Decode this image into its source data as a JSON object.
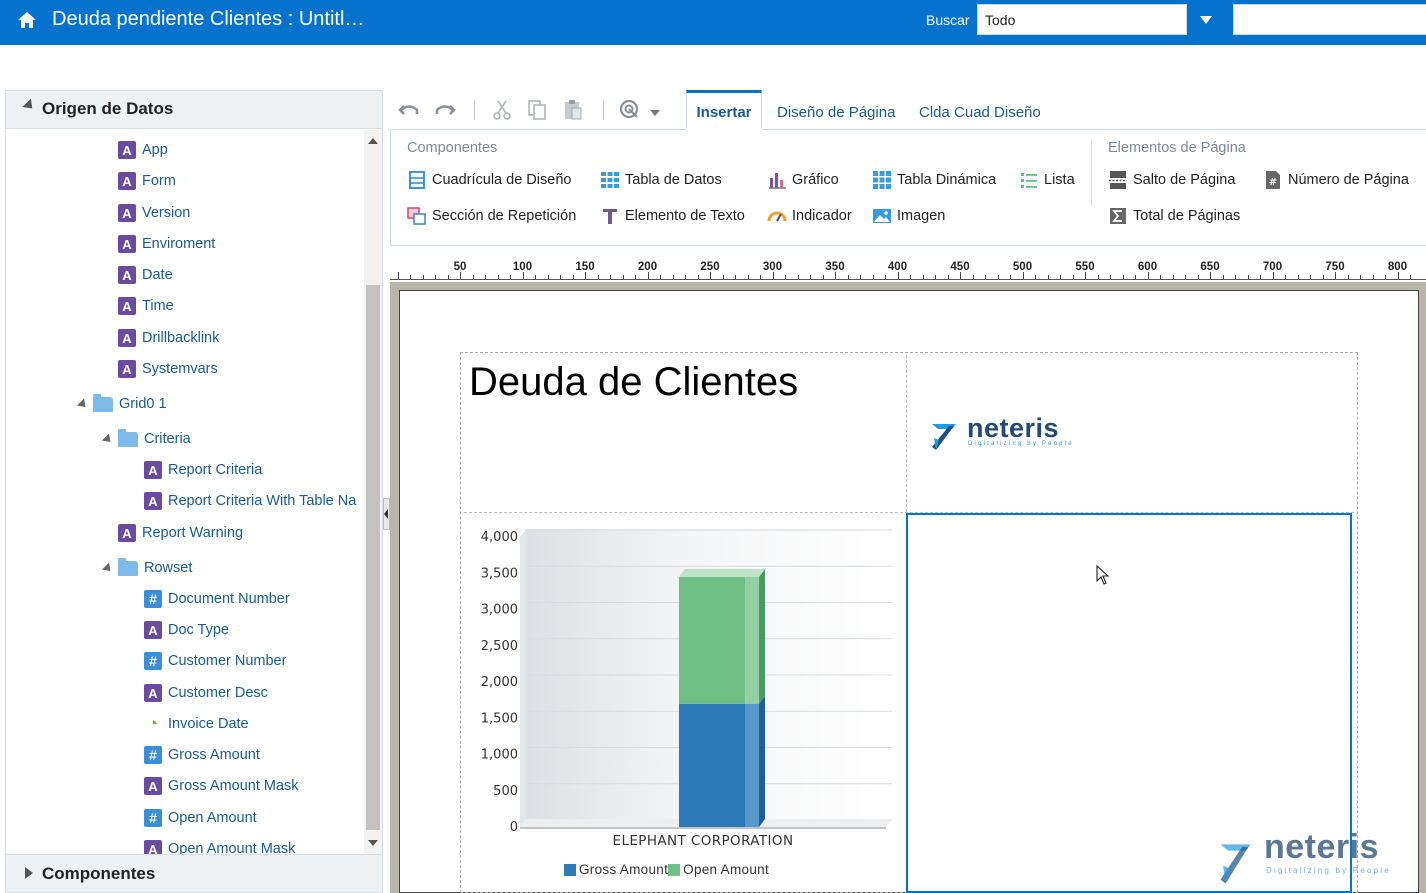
{
  "header": {
    "title": "Deuda pendiente Clientes : Untitl…",
    "search_label": "Buscar",
    "search_scope": "Todo",
    "search_value": ""
  },
  "data_source": {
    "title": "Origen de Datos",
    "items": [
      {
        "label": "App",
        "icon": "text-field-icon"
      },
      {
        "label": "Form",
        "icon": "text-field-icon"
      },
      {
        "label": "Version",
        "icon": "text-field-icon"
      },
      {
        "label": "Enviroment",
        "icon": "text-field-icon"
      },
      {
        "label": "Date",
        "icon": "text-field-icon"
      },
      {
        "label": "Time",
        "icon": "text-field-icon"
      },
      {
        "label": "Drillbacklink",
        "icon": "text-field-icon"
      },
      {
        "label": "Systemvars",
        "icon": "text-field-icon"
      },
      {
        "label": "Grid0 1",
        "icon": "folder-icon"
      },
      {
        "label": "Criteria",
        "icon": "folder-icon"
      },
      {
        "label": "Report Criteria",
        "icon": "text-field-icon"
      },
      {
        "label": "Report Criteria With Table Na",
        "icon": "text-field-icon"
      },
      {
        "label": "Report Warning",
        "icon": "text-field-icon"
      },
      {
        "label": "Rowset",
        "icon": "folder-icon"
      },
      {
        "label": "Document Number",
        "icon": "number-field-icon"
      },
      {
        "label": "Doc Type",
        "icon": "text-field-icon"
      },
      {
        "label": "Customer Number",
        "icon": "number-field-icon"
      },
      {
        "label": "Customer Desc",
        "icon": "text-field-icon"
      },
      {
        "label": "Invoice Date",
        "icon": "date-field-icon"
      },
      {
        "label": "Gross Amount",
        "icon": "number-field-icon"
      },
      {
        "label": "Gross Amount Mask",
        "icon": "text-field-icon"
      },
      {
        "label": "Open Amount",
        "icon": "number-field-icon"
      },
      {
        "label": "Open Amount Mask",
        "icon": "text-field-icon"
      }
    ],
    "components_title": "Componentes"
  },
  "tabs": [
    {
      "label": "Insertar",
      "active": true
    },
    {
      "label": "Diseño de Página",
      "active": false
    },
    {
      "label": "Clda Cuad Diseño",
      "active": false
    }
  ],
  "ribbon": {
    "components_group": "Componentes",
    "page_elements_group": "Elementos de Página",
    "components": [
      {
        "label": "Cuadrícula de Diseño",
        "icon": "layout-grid-icon"
      },
      {
        "label": "Tabla de Datos",
        "icon": "data-table-icon"
      },
      {
        "label": "Gráfico",
        "icon": "bar-chart-icon"
      },
      {
        "label": "Tabla Dinámica",
        "icon": "pivot-table-icon"
      },
      {
        "label": "Lista",
        "icon": "list-icon"
      },
      {
        "label": "Sección de Repetición",
        "icon": "repeating-section-icon"
      },
      {
        "label": "Elemento de Texto",
        "icon": "text-item-icon"
      },
      {
        "label": "Indicador",
        "icon": "gauge-icon"
      },
      {
        "label": "Imagen",
        "icon": "image-icon"
      }
    ],
    "page_elements": [
      {
        "label": "Salto de Página",
        "icon": "page-break-icon"
      },
      {
        "label": "Número de Página",
        "icon": "page-number-icon"
      },
      {
        "label": "Total de Páginas",
        "icon": "total-pages-icon"
      }
    ]
  },
  "ruler": {
    "labels": [
      "50",
      "100",
      "150",
      "200",
      "250",
      "300",
      "350",
      "400",
      "450",
      "500",
      "550",
      "600",
      "650",
      "700",
      "750",
      "800"
    ]
  },
  "report": {
    "title": "Deuda de Clientes",
    "logo_word": "neteris",
    "logo_tagline": "Digitalizing by People"
  },
  "watermark": {
    "word": "neteris",
    "tagline": "Digitalizing by People"
  },
  "colors": {
    "brand": "#0572ce",
    "gross": "#2e7ab8",
    "open": "#6fbf84"
  },
  "chart_data": {
    "type": "bar",
    "stacked": true,
    "categories": [
      "ELEPHANT CORPORATION"
    ],
    "series": [
      {
        "name": "Gross Amount",
        "values": [
          1700
        ]
      },
      {
        "name": "Open Amount",
        "values": [
          1750
        ]
      }
    ],
    "ylim": [
      0,
      4000
    ],
    "yticks": [
      "0",
      "500",
      "1,000",
      "1,500",
      "2,000",
      "2,500",
      "3,000",
      "3,500",
      "4,000"
    ],
    "grid": true,
    "legend": "bottom"
  }
}
